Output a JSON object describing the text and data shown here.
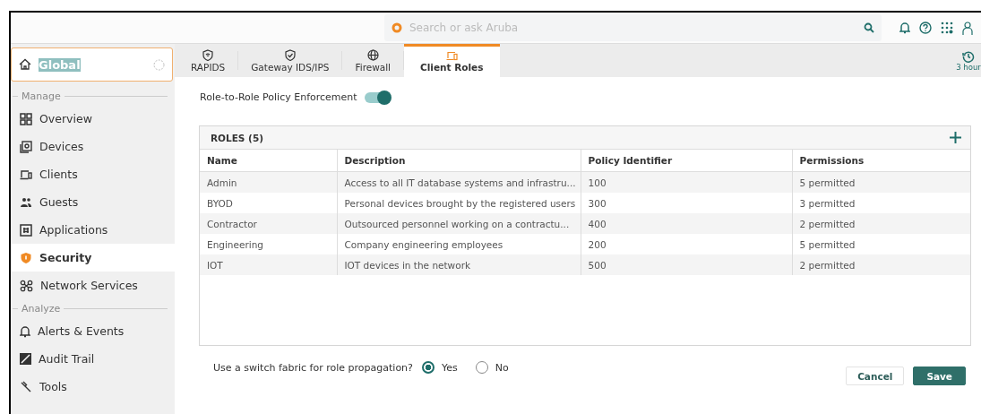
{
  "top_bar": {
    "search": {
      "placeholder": "Search or ask Aruba"
    }
  },
  "scope": {
    "value": "Global"
  },
  "sidebar": {
    "items": [
      {
        "kind": "header",
        "label": "Manage"
      },
      {
        "kind": "item",
        "label": "Overview",
        "selected": false
      },
      {
        "kind": "item",
        "label": "Devices",
        "selected": false
      },
      {
        "kind": "item",
        "label": "Clients",
        "selected": false
      },
      {
        "kind": "item",
        "label": "Guests",
        "selected": false
      },
      {
        "kind": "item",
        "label": "Applications",
        "selected": false
      },
      {
        "kind": "item",
        "label": "Security",
        "selected": true
      },
      {
        "kind": "item",
        "label": "Network Services",
        "selected": false
      },
      {
        "kind": "header",
        "label": "Analyze"
      },
      {
        "kind": "item",
        "label": "Alerts & Events",
        "selected": false
      },
      {
        "kind": "item",
        "label": "Audit Trail",
        "selected": false
      },
      {
        "kind": "item",
        "label": "Tools",
        "selected": false
      }
    ]
  },
  "tabs": [
    {
      "label": "RAPIDS",
      "selected": false
    },
    {
      "label": "Gateway IDS/IPS",
      "selected": false
    },
    {
      "label": "Firewall",
      "selected": false
    },
    {
      "label": "Client Roles",
      "selected": true
    }
  ],
  "time_range": {
    "label": "3 hour"
  },
  "enforcement": {
    "label": "Role-to-Role Policy Enforcement",
    "on": true
  },
  "table": {
    "title": "ROLES (5)",
    "columns": [
      "Name",
      "Description",
      "Policy Identifier",
      "Permissions"
    ],
    "rows": [
      [
        "Admin",
        "Access to all IT database systems and infrastru...",
        "100",
        "5 permitted"
      ],
      [
        "BYOD",
        "Personal devices brought by the registered users",
        "300",
        "3 permitted"
      ],
      [
        "Contractor",
        "Outsourced personnel working on a contractu...",
        "400",
        "2 permitted"
      ],
      [
        "Engineering",
        "Company engineering employees",
        "200",
        "5 permitted"
      ],
      [
        "IOT",
        "IOT devices in the network",
        "500",
        "2 permitted"
      ]
    ]
  },
  "propagation": {
    "question": "Use a switch fabric for role propagation?",
    "options": [
      {
        "label": "Yes",
        "selected": true
      },
      {
        "label": "No",
        "selected": false
      }
    ]
  },
  "buttons": [
    {
      "label": "Cancel",
      "kind": "secondary"
    },
    {
      "label": "Save",
      "kind": "primary"
    }
  ]
}
